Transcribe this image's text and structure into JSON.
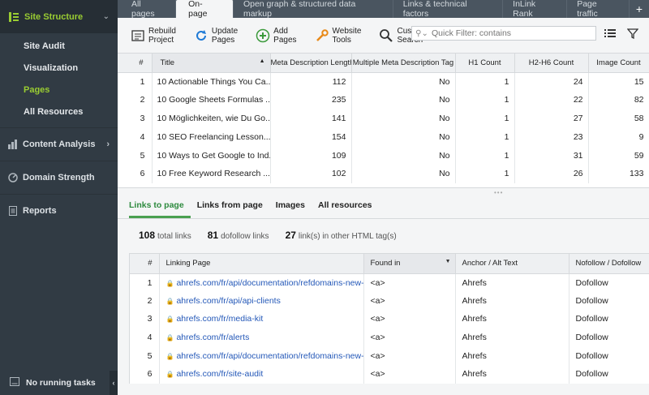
{
  "sidebar": {
    "header": "Site Structure",
    "sub_items": [
      "Site Audit",
      "Visualization",
      "Pages",
      "All Resources"
    ],
    "active_sub": "Pages",
    "sections": [
      "Content Analysis",
      "Domain Strength",
      "Reports"
    ],
    "bottom_status": "No running tasks",
    "accent_color": "#9acd32"
  },
  "tabs": [
    "All pages",
    "On-page",
    "Open graph & structured data markup",
    "Links & technical factors",
    "InLink Rank",
    "Page traffic"
  ],
  "active_tab": "On-page",
  "toolbar": {
    "rebuild_label": "Rebuild\nProject",
    "update_label": "Update\nPages",
    "add_label": "Add\nPages",
    "website_tools_label": "Website\nTools",
    "custom_search_label": "Custom\nSearch",
    "filter_placeholder": "Quick Filter: contains"
  },
  "pages_table": {
    "columns": [
      "#",
      "Title",
      "Meta Description Length",
      "Multiple Meta Description Tag",
      "H1 Count",
      "H2-H6 Count",
      "Image Count"
    ],
    "rows": [
      [
        "1",
        "10 Actionable Things You Ca...",
        "112",
        "No",
        "1",
        "24",
        "15"
      ],
      [
        "2",
        "10 Google Sheets Formulas ...",
        "235",
        "No",
        "1",
        "22",
        "82"
      ],
      [
        "3",
        "10 Möglichkeiten, wie Du Go...",
        "141",
        "No",
        "1",
        "27",
        "58"
      ],
      [
        "4",
        "10 SEO Freelancing Lesson...",
        "154",
        "No",
        "1",
        "23",
        "9"
      ],
      [
        "5",
        "10 Ways to Get Google to Ind...",
        "109",
        "No",
        "1",
        "31",
        "59"
      ],
      [
        "6",
        "10 Free Keyword Research ...",
        "102",
        "No",
        "1",
        "26",
        "133"
      ]
    ]
  },
  "lower_tabs": [
    "Links to page",
    "Links from page",
    "Images",
    "All resources"
  ],
  "active_lower_tab": "Links to page",
  "stats": [
    {
      "value": "108",
      "label": "total links"
    },
    {
      "value": "81",
      "label": "dofollow links"
    },
    {
      "value": "27",
      "label": "link(s) in other HTML tag(s)"
    }
  ],
  "links_table": {
    "columns": [
      "#",
      "Linking Page",
      "Found in",
      "Anchor / Alt Text",
      "Nofollow / Dofollow"
    ],
    "rows": [
      [
        "1",
        "ahrefs.com/fr/api/documentation/refdomains-new-lost",
        "<a>",
        "Ahrefs",
        "Dofollow"
      ],
      [
        "2",
        "ahrefs.com/fr/api/api-clients",
        "<a>",
        "Ahrefs",
        "Dofollow"
      ],
      [
        "3",
        "ahrefs.com/fr/media-kit",
        "<a>",
        "Ahrefs",
        "Dofollow"
      ],
      [
        "4",
        "ahrefs.com/fr/alerts",
        "<a>",
        "Ahrefs",
        "Dofollow"
      ],
      [
        "5",
        "ahrefs.com/fr/api/documentation/refdomains-new-lo...",
        "<a>",
        "Ahrefs",
        "Dofollow"
      ],
      [
        "6",
        "ahrefs.com/fr/site-audit",
        "<a>",
        "Ahrefs",
        "Dofollow"
      ]
    ]
  }
}
